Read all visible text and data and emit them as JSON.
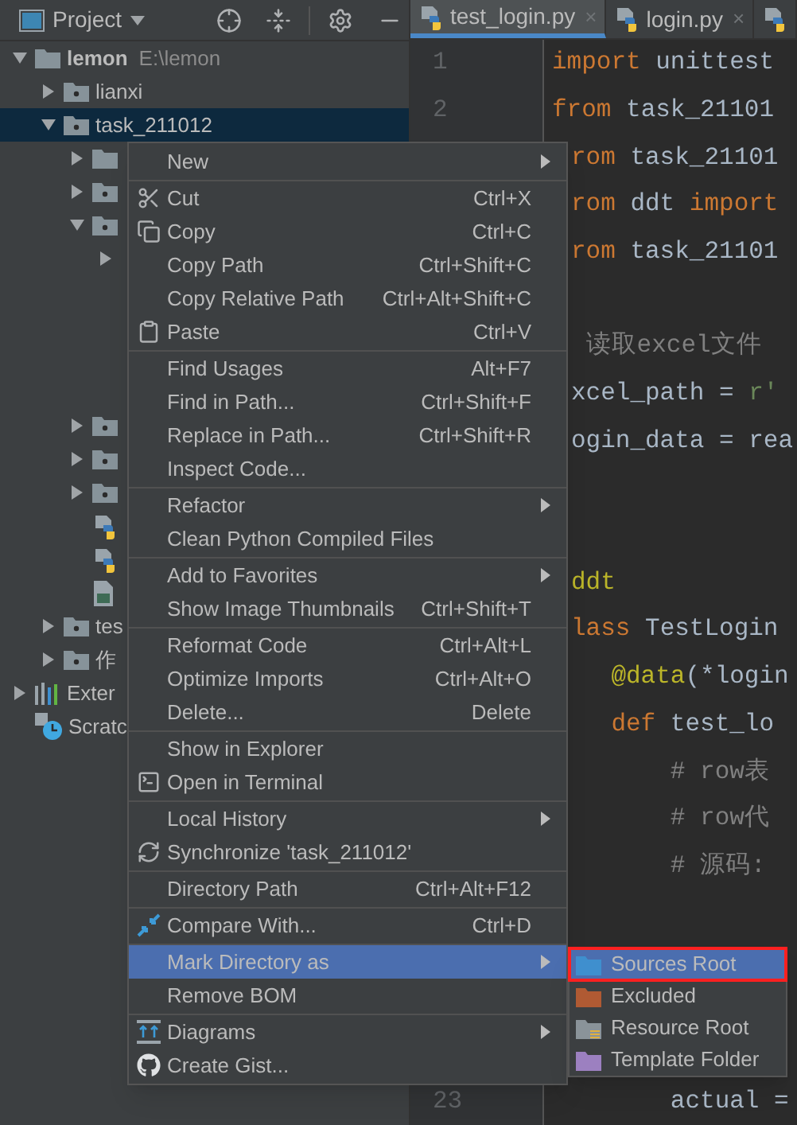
{
  "project_panel": {
    "title": "Project",
    "tree": [
      {
        "kind": "folder",
        "name": "lemon",
        "path": "E:\\lemon",
        "expanded": true,
        "selected": false,
        "children": [
          {
            "kind": "package",
            "name": "lianxi",
            "expanded": false,
            "selected": false
          },
          {
            "kind": "package",
            "name": "task_211012",
            "expanded": true,
            "selected": true,
            "children": [
              {
                "kind": "folder",
                "expanded": false,
                "selected": false
              },
              {
                "kind": "package",
                "expanded": false,
                "selected": false
              },
              {
                "kind": "package",
                "expanded": true,
                "selected": false,
                "children": [
                  {
                    "kind": "arrow-only",
                    "expanded": false,
                    "selected": false
                  },
                  {
                    "kind": "hidden"
                  },
                  {
                    "kind": "hidden"
                  },
                  {
                    "kind": "hidden"
                  },
                  {
                    "kind": "hidden"
                  }
                ]
              },
              {
                "kind": "package",
                "expanded": false,
                "selected": false
              },
              {
                "kind": "package",
                "expanded": false,
                "selected": false
              },
              {
                "kind": "package",
                "expanded": false,
                "selected": false
              },
              {
                "kind": "python",
                "selected": false
              },
              {
                "kind": "python",
                "selected": false
              },
              {
                "kind": "image",
                "selected": false
              }
            ]
          },
          {
            "kind": "package",
            "name": "tes",
            "expanded": false,
            "selected": false
          },
          {
            "kind": "package",
            "name": "作",
            "expanded": false,
            "selected": false
          }
        ]
      },
      {
        "kind": "library",
        "name": "Exter",
        "expanded": false,
        "selected": false
      },
      {
        "kind": "scratch",
        "name": "Scratc",
        "selected": false
      }
    ]
  },
  "tabs": [
    {
      "label": "test_login.py",
      "close": "×",
      "selected": true
    },
    {
      "label": "login.py",
      "close": "×",
      "selected": false
    },
    {
      "selected": false
    }
  ],
  "code": [
    {
      "kind": "code",
      "number": "1",
      "segments": [
        {
          "text": "import",
          "kind": "keyword"
        },
        {
          "text": " unittest",
          "kind": "plain"
        }
      ]
    },
    {
      "kind": "code",
      "number": "2",
      "segments": [
        {
          "text": "from",
          "kind": "keyword"
        },
        {
          "text": " task_21101",
          "kind": "plain"
        }
      ]
    },
    {
      "kind": "cut",
      "segments": [
        {
          "text": "rom",
          "kind": "keyword"
        },
        {
          "text": " task_21101",
          "kind": "plain"
        }
      ]
    },
    {
      "kind": "cut",
      "segments": [
        {
          "text": "rom",
          "kind": "keyword"
        },
        {
          "text": " ddt ",
          "kind": "plain"
        },
        {
          "text": "import",
          "kind": "keyword"
        }
      ]
    },
    {
      "kind": "cut",
      "segments": [
        {
          "text": "rom",
          "kind": "keyword"
        },
        {
          "text": " task_21101",
          "kind": "plain"
        }
      ]
    },
    {
      "kind": "blank"
    },
    {
      "kind": "cut",
      "segments": [
        {
          "text": " 读取excel文件",
          "kind": "comment"
        }
      ]
    },
    {
      "kind": "cut",
      "segments": [
        {
          "text": "xcel_path = ",
          "kind": "plain"
        },
        {
          "text": "r'",
          "kind": "string"
        }
      ]
    },
    {
      "kind": "cut",
      "segments": [
        {
          "text": "ogin_data = rea",
          "kind": "plain"
        }
      ]
    },
    {
      "kind": "blank"
    },
    {
      "kind": "blank"
    },
    {
      "kind": "cut",
      "segments": [
        {
          "text": "ddt",
          "kind": "decorator"
        }
      ]
    },
    {
      "kind": "cut",
      "segments": [
        {
          "text": "lass",
          "kind": "keyword"
        },
        {
          "text": " TestLogin",
          "kind": "plain"
        }
      ]
    },
    {
      "kind": "code",
      "segments": [
        {
          "text": "    @data",
          "kind": "decorator"
        },
        {
          "text": "(*login",
          "kind": "plain"
        }
      ]
    },
    {
      "kind": "code",
      "segments": [
        {
          "text": "    def",
          "kind": "keyword"
        },
        {
          "text": " test_lo",
          "kind": "plain"
        }
      ]
    },
    {
      "kind": "code",
      "segments": [
        {
          "text": "        # row表",
          "kind": "comment"
        }
      ]
    },
    {
      "kind": "code",
      "segments": [
        {
          "text": "        # row代",
          "kind": "comment"
        }
      ]
    },
    {
      "kind": "code",
      "segments": [
        {
          "text": "        # 源码:",
          "kind": "comment"
        }
      ]
    },
    {
      "kind": "blank"
    },
    {
      "kind": "blank"
    },
    {
      "kind": "blank"
    },
    {
      "kind": "blank"
    },
    {
      "kind": "code",
      "number": "23",
      "segments": [
        {
          "text": "        actual =",
          "kind": "plain"
        }
      ]
    }
  ],
  "context_menu": [
    [
      {
        "label": "New",
        "submenu": true,
        "selected": false
      }
    ],
    [
      {
        "label": "Cut",
        "shortcut": "Ctrl+X",
        "submenu": false,
        "selected": false
      },
      {
        "label": "Copy",
        "shortcut": "Ctrl+C",
        "submenu": false,
        "selected": false
      },
      {
        "label": "Copy Path",
        "shortcut": "Ctrl+Shift+C",
        "submenu": false,
        "selected": false
      },
      {
        "label": "Copy Relative Path",
        "shortcut": "Ctrl+Alt+Shift+C",
        "submenu": false,
        "selected": false
      },
      {
        "label": "Paste",
        "shortcut": "Ctrl+V",
        "submenu": false,
        "selected": false
      }
    ],
    [
      {
        "label": "Find Usages",
        "shortcut": "Alt+F7",
        "submenu": false,
        "selected": false
      },
      {
        "label": "Find in Path...",
        "shortcut": "Ctrl+Shift+F",
        "submenu": false,
        "selected": false
      },
      {
        "label": "Replace in Path...",
        "shortcut": "Ctrl+Shift+R",
        "submenu": false,
        "selected": false
      },
      {
        "label": "Inspect Code...",
        "submenu": false,
        "selected": false
      }
    ],
    [
      {
        "label": "Refactor",
        "submenu": true,
        "selected": false
      },
      {
        "label": "Clean Python Compiled Files",
        "submenu": false,
        "selected": false
      }
    ],
    [
      {
        "label": "Add to Favorites",
        "submenu": true,
        "selected": false
      },
      {
        "label": "Show Image Thumbnails",
        "shortcut": "Ctrl+Shift+T",
        "submenu": false,
        "selected": false
      }
    ],
    [
      {
        "label": "Reformat Code",
        "shortcut": "Ctrl+Alt+L",
        "submenu": false,
        "selected": false
      },
      {
        "label": "Optimize Imports",
        "shortcut": "Ctrl+Alt+O",
        "submenu": false,
        "selected": false
      },
      {
        "label": "Delete...",
        "shortcut": "Delete",
        "submenu": false,
        "selected": false
      }
    ],
    [
      {
        "label": "Show in Explorer",
        "submenu": false,
        "selected": false
      },
      {
        "label": "Open in Terminal",
        "submenu": false,
        "selected": false
      }
    ],
    [
      {
        "label": "Local History",
        "submenu": true,
        "selected": false
      },
      {
        "label": "Synchronize 'task_211012'",
        "submenu": false,
        "selected": false
      }
    ],
    [
      {
        "label": "Directory Path",
        "shortcut": "Ctrl+Alt+F12",
        "submenu": false,
        "selected": false
      }
    ],
    [
      {
        "label": "Compare With...",
        "shortcut": "Ctrl+D",
        "submenu": false,
        "selected": false
      }
    ],
    [
      {
        "label": "Mark Directory as",
        "submenu": true,
        "selected": true
      },
      {
        "label": "Remove BOM",
        "submenu": false,
        "selected": false
      }
    ],
    [
      {
        "label": "Diagrams",
        "submenu": true,
        "selected": false
      },
      {
        "label": "Create Gist...",
        "submenu": false,
        "selected": false
      }
    ]
  ],
  "submenu": [
    {
      "label": "Sources Root",
      "color": "#3f8fce",
      "selected": true,
      "annotated": true
    },
    {
      "label": "Excluded",
      "color": "#b05a33",
      "selected": false,
      "annotated": false
    },
    {
      "label": "Resource Root",
      "color": "#8a9399",
      "selected": false,
      "annotated": false
    },
    {
      "label": "Template Folder",
      "color": "#9c80c0",
      "selected": false,
      "annotated": false
    }
  ]
}
